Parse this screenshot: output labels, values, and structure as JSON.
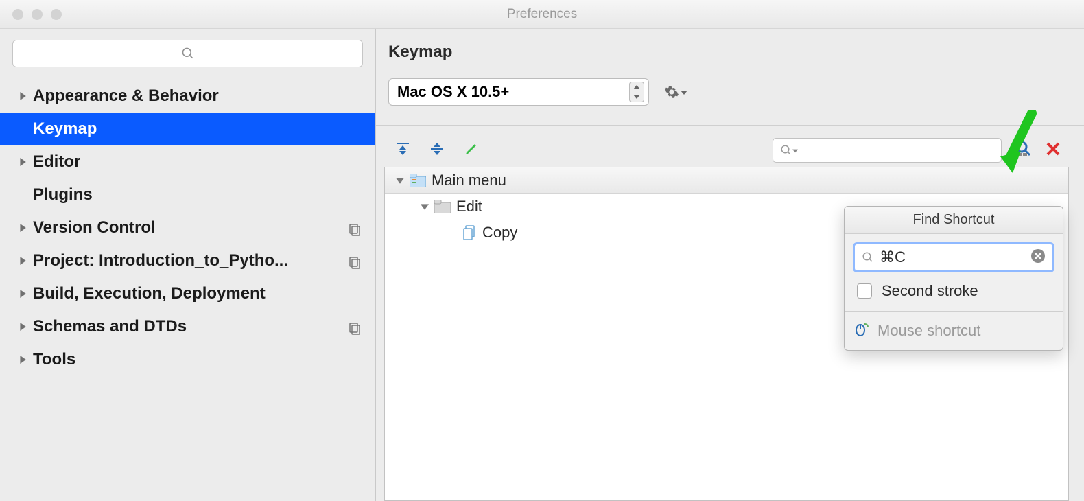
{
  "window": {
    "title": "Preferences"
  },
  "sidebar": {
    "items": [
      {
        "label": "Appearance & Behavior"
      },
      {
        "label": "Keymap"
      },
      {
        "label": "Editor"
      },
      {
        "label": "Plugins"
      },
      {
        "label": "Version Control"
      },
      {
        "label": "Project: Introduction_to_Pytho..."
      },
      {
        "label": "Build, Execution, Deployment"
      },
      {
        "label": "Schemas and DTDs"
      },
      {
        "label": "Tools"
      }
    ]
  },
  "main": {
    "title": "Keymap",
    "scheme": "Mac OS X 10.5+",
    "tree": {
      "root": "Main menu",
      "child": "Edit",
      "leaf": "Copy"
    }
  },
  "popover": {
    "title": "Find Shortcut",
    "value": "⌘C",
    "second_stroke": "Second stroke",
    "mouse": "Mouse shortcut"
  }
}
